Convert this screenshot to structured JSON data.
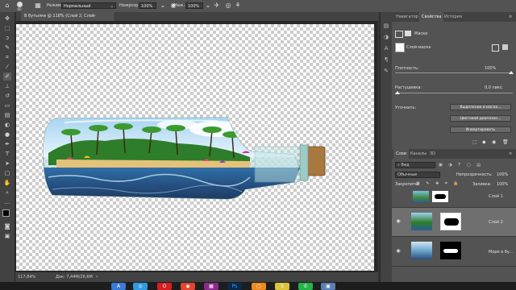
{
  "options_bar": {
    "mode_label": "Режим:",
    "mode_value": "Нормальный",
    "pressure_label": "Нажрсор:",
    "pressure_value": "100%",
    "flow_label": "Наж.:",
    "flow_value": "100%",
    "brush_size": "60"
  },
  "document": {
    "tab_title": "В бутылке @ 118% (Слой 2, Слой-маска/8)"
  },
  "status": {
    "zoom": "117,84%",
    "doc_info": "Док: 7,44M/26,6M"
  },
  "panel_tabs": [
    "Навигатор",
    "Свойства",
    "История"
  ],
  "properties": {
    "section_title": "Маски",
    "mask_type": "Слой-маска",
    "density_label": "Плотность:",
    "density_value": "100%",
    "feather_label": "Растушевка:",
    "feather_value": "0,0 пикс.",
    "refine_label": "Уточнить:",
    "refine_buttons": [
      "Выделение и маска...",
      "Цветовой диапазон...",
      "Инвертировать"
    ]
  },
  "layers_panel": {
    "tabs": [
      "Слои",
      "Каналы",
      "3D"
    ],
    "kind_label": "Вид",
    "blend_mode": "Обычные",
    "opacity_label": "Непрозрачность:",
    "opacity_value": "100%",
    "lock_label": "Закрепить:",
    "fill_label": "Заливка:",
    "fill_value": "100%",
    "layers": [
      {
        "name": "Слой 1"
      },
      {
        "name": "Слой 2"
      },
      {
        "name": "Море в бу..."
      }
    ]
  },
  "colors": {
    "accent": "#31a8ff",
    "panel_bg": "#535353",
    "dark_bg": "#323232"
  }
}
